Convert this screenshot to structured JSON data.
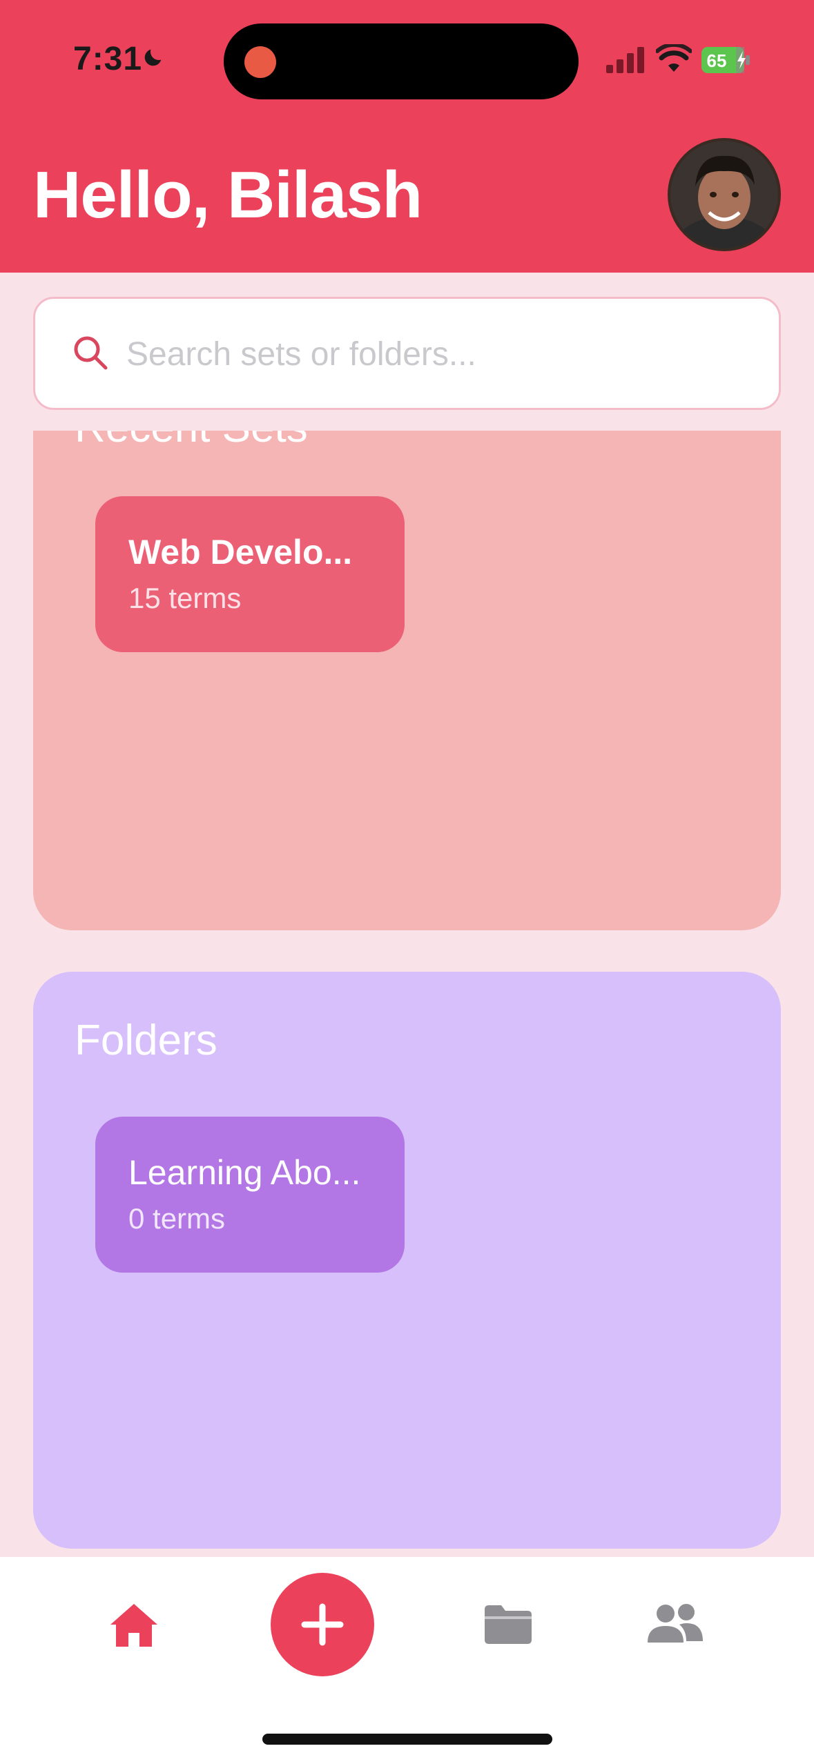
{
  "status_bar": {
    "time": "7:31",
    "battery": "65"
  },
  "header": {
    "greeting": "Hello, Bilash"
  },
  "search": {
    "placeholder": "Search sets or folders..."
  },
  "recent_sets": {
    "title": "Recent Sets",
    "items": [
      {
        "title": "Web Develo...",
        "subtitle": "15 terms"
      }
    ]
  },
  "folders": {
    "title": "Folders",
    "items": [
      {
        "title": "Learning Abo...",
        "subtitle": "0 terms"
      }
    ]
  },
  "colors": {
    "primary": "#EC415B",
    "background": "#F9E3E8",
    "recent_card": "#F5B5B5",
    "set_tile": "#EC6076",
    "folders_card": "#D6BFFB",
    "folder_tile": "#B377E5",
    "tab_inactive": "#8E8E93"
  },
  "tabs": [
    {
      "icon": "home-icon",
      "active": true
    },
    {
      "icon": "plus-icon",
      "active": false
    },
    {
      "icon": "folder-icon",
      "active": false
    },
    {
      "icon": "people-icon",
      "active": false
    }
  ]
}
